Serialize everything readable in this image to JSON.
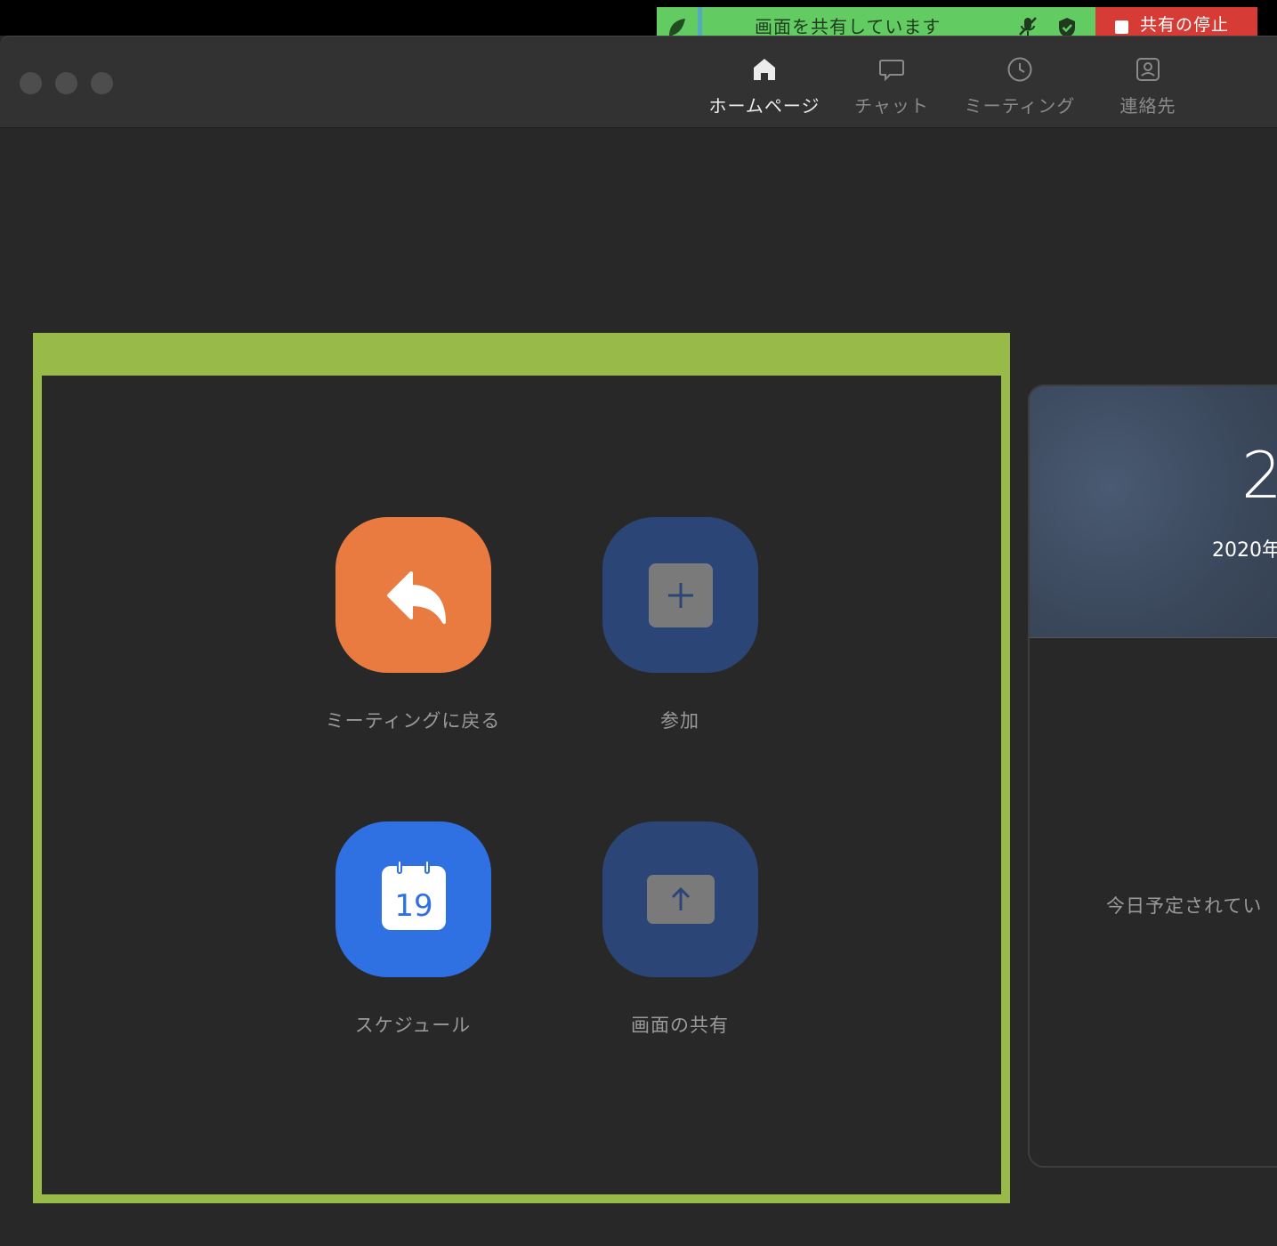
{
  "share_banner": {
    "text": "画面を共有しています",
    "stop_label": "共有の停止"
  },
  "nav": {
    "tabs": [
      {
        "label": "ホームページ",
        "icon": "home-icon",
        "active": true
      },
      {
        "label": "チャット",
        "icon": "chat-icon",
        "active": false
      },
      {
        "label": "ミーティング",
        "icon": "clock-icon",
        "active": false
      },
      {
        "label": "連絡先",
        "icon": "contacts-icon",
        "active": false
      }
    ]
  },
  "actions": [
    {
      "label": "ミーティングに戻る",
      "icon": "reply-arrow-icon",
      "color": "#e97a40"
    },
    {
      "label": "参加",
      "icon": "plus-icon",
      "color": "#2b4676"
    },
    {
      "label": "スケジュール",
      "icon": "calendar-icon",
      "color": "#2f70e3",
      "calendar_day": "19"
    },
    {
      "label": "画面の共有",
      "icon": "share-up-arrow-icon",
      "color": "#2b4676"
    }
  ],
  "side_card": {
    "time_partial": "2",
    "date_partial": "2020年",
    "empty_message": "今日予定されてい"
  },
  "colors": {
    "highlight": "#97ba49",
    "banner_green": "#62cc62",
    "stop_red": "#d63b35",
    "background": "#282828"
  }
}
